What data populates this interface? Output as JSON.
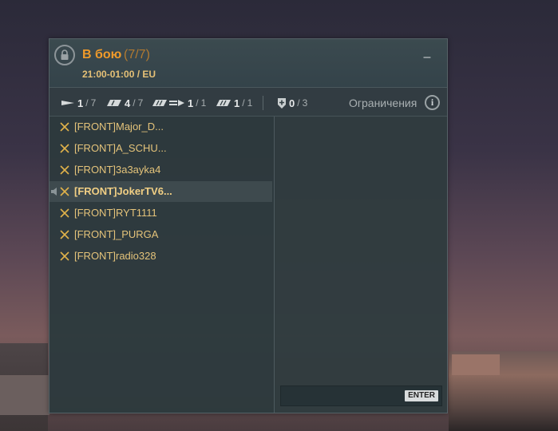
{
  "header": {
    "title": "В бою",
    "count": "(7/7)",
    "schedule": "21:00-01:00 / EU",
    "lock_icon": "lock-icon",
    "minimize_label": "–"
  },
  "filters": [
    {
      "icon": "destroyer-icon",
      "current": "1",
      "total": "7"
    },
    {
      "icon": "cruiser-icon",
      "current": "4",
      "total": "7"
    },
    {
      "icon": "battleship-icon",
      "current": "1",
      "total": "1"
    },
    {
      "icon": "carrier-icon",
      "current": "1",
      "total": "1"
    },
    {
      "icon": "shield-plus-icon",
      "current": "0",
      "total": "3"
    }
  ],
  "restrictions_label": "Ограничения",
  "info_label": "i",
  "members": [
    {
      "name": "[FRONT]Major_D...",
      "selected": false
    },
    {
      "name": "[FRONT]A_SCHU...",
      "selected": false
    },
    {
      "name": "[FRONT]3a3ayka4",
      "selected": false
    },
    {
      "name": "[FRONT]JokerTV6...",
      "selected": true
    },
    {
      "name": "[FRONT]RYT1111",
      "selected": false
    },
    {
      "name": "[FRONT]_PURGA",
      "selected": false
    },
    {
      "name": "[FRONT]radio328",
      "selected": false
    }
  ],
  "chat": {
    "enter_label": "ENTER"
  },
  "colors": {
    "accent": "#ef9a2a",
    "member_name": "#e4c37a",
    "panel_bg": "#323e42"
  }
}
